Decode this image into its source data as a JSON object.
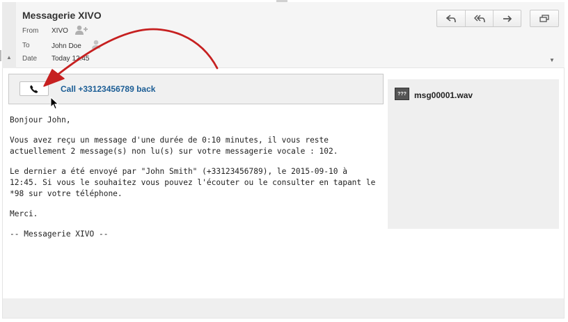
{
  "header": {
    "subject": "Messagerie XIVO",
    "from_label": "From",
    "from_value": "XIVO",
    "to_label": "To",
    "to_value": "John Doe",
    "date_label": "Date",
    "date_value": "Today 12:45"
  },
  "toolbar": {
    "reply_icon": "reply-icon",
    "reply_all_icon": "reply-all-icon",
    "forward_icon": "forward-icon",
    "popout_icon": "open-window-icon"
  },
  "call": {
    "link_text": "Call +33123456789 back",
    "button_icon": "phone-icon"
  },
  "body": {
    "paragraphs": [
      "Bonjour John,",
      "Vous avez reçu un message d'une durée de 0:10 minutes, il vous reste\nactuellement 2 message(s) non lu(s) sur votre messagerie vocale : 102.",
      "Le dernier a été envoyé par \"John Smith\" (+33123456789), le 2015-09-10 à\n12:45. Si vous le souhaitez vous pouvez l'écouter ou le consulter en tapant le\n*98 sur votre téléphone.",
      "Merci.",
      "-- Messagerie XIVO --"
    ]
  },
  "attachment": {
    "icon_text": "???",
    "file_name": "msg00001.wav"
  },
  "colors": {
    "link": "#1b5d95",
    "annotation_arrow": "#c62020"
  }
}
